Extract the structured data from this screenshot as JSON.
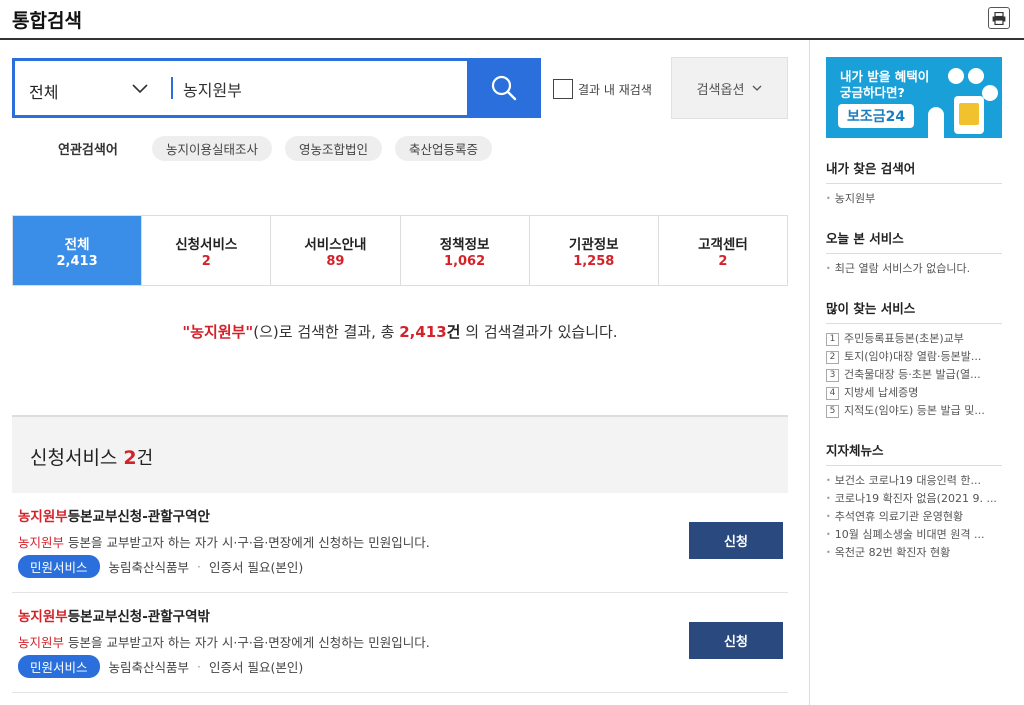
{
  "header": {
    "title": "통합검색",
    "print_icon": "printer-icon"
  },
  "search": {
    "scope": "전체",
    "query": "농지원부",
    "search_icon": "search-icon",
    "research_label": "결과 내 재검색",
    "option_label": "검색옵션"
  },
  "related": {
    "label": "연관검색어",
    "tags": [
      "농지이용실태조사",
      "영농조합법인",
      "축산업등록증"
    ]
  },
  "tabs": [
    {
      "label": "전체",
      "count": "2,413"
    },
    {
      "label": "신청서비스",
      "count": "2"
    },
    {
      "label": "서비스안내",
      "count": "89"
    },
    {
      "label": "정책정보",
      "count": "1,062"
    },
    {
      "label": "기관정보",
      "count": "1,258"
    },
    {
      "label": "고객센터",
      "count": "2"
    }
  ],
  "summary": {
    "keyword": "\"농지원부\"",
    "text1": "(으)로 검색한 결과, 총 ",
    "total": "2,413",
    "unit": "건",
    "text2": " 의 검색결과가 있습니다."
  },
  "section": {
    "title": "신청서비스",
    "count": "2",
    "unit": "건"
  },
  "results": [
    {
      "title_kw": "농지원부",
      "title_rest": "등본교부신청-관할구역안",
      "desc_kw": "농지원부",
      "desc_rest": " 등본을 교부받고자 하는 자가 시·구·읍·면장에게 신청하는 민원입니다.",
      "badge": "민원서비스",
      "org": "농림축산식품부",
      "auth": "인증서 필요(본인)",
      "button": "신청"
    },
    {
      "title_kw": "농지원부",
      "title_rest": "등본교부신청-관할구역밖",
      "desc_kw": "농지원부",
      "desc_rest": " 등본을 교부받고자 하는 자가 시·구·읍·면장에게 신청하는 민원입니다.",
      "badge": "민원서비스",
      "org": "농림축산식품부",
      "auth": "인증서 필요(본인)",
      "button": "신청"
    }
  ],
  "sidebar": {
    "banner": {
      "line1": "내가 받을 혜택이",
      "line2": "궁금하다면?",
      "pill": "보조금24"
    },
    "my_searches": {
      "title": "내가 찾은 검색어",
      "items": [
        "농지원부"
      ]
    },
    "today_viewed": {
      "title": "오늘 본 서비스",
      "items": [
        "최근 열람 서비스가 없습니다."
      ]
    },
    "popular": {
      "title": "많이 찾는 서비스",
      "items": [
        {
          "rank": "1",
          "text": "주민등록표등본(초본)교부"
        },
        {
          "rank": "2",
          "text": "토지(임야)대장 열람·등본발..."
        },
        {
          "rank": "3",
          "text": "건축물대장 등·초본 발급(열..."
        },
        {
          "rank": "4",
          "text": "지방세 납세증명"
        },
        {
          "rank": "5",
          "text": "지적도(임야도) 등본 발급 및..."
        }
      ]
    },
    "local_news": {
      "title": "지자체뉴스",
      "items": [
        "보건소 코로나19 대응인력 한...",
        "코로나19 확진자 없음(2021 9. ...",
        "추석연휴 의료기관 운영현황",
        "10월 심폐소생술 비대면 원격 ...",
        "옥천군 82번 확진자 현황"
      ]
    }
  },
  "colors": {
    "primary": "#2a6fdb",
    "tab_active": "#3b8ee8",
    "highlight": "#d4222a",
    "apply_button": "#2a4a7f",
    "banner": "#1aa0d8"
  }
}
